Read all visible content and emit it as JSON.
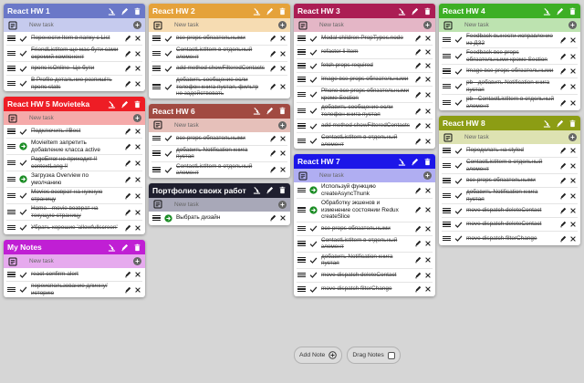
{
  "actions": {
    "add_note": "Add Note",
    "drag_notes": "Drag Notes"
  },
  "new_task_placeholder": "New task",
  "columns": [
    [
      {
        "title": "React HW 1",
        "header": "#6a78c8",
        "newtask": "#c6cbee",
        "tasks": [
          {
            "text": "Перенести Item в папку с List",
            "done": true
          },
          {
            "text": "FriendListItem ще має бути сами окремий компонент",
            "done": true
          },
          {
            "text": "пропс isOnline- Це бути",
            "done": true
          },
          {
            "text": "В Profile детальние розпишіть пропс stats",
            "done": true
          }
        ]
      },
      {
        "title": "React HW 5 Movieteka",
        "header": "#ee1d25",
        "newtask": "#f5aaaa",
        "tasks": [
          {
            "text": "Подключить //Best",
            "done": true
          },
          {
            "text": "MovieItem запретить добавление класса active",
            "done": false
          },
          {
            "text": "PageError не приходит !! contextLang !!",
            "done": true
          },
          {
            "text": "Загрузка Overview по умолчанию",
            "done": false
          },
          {
            "text": "Movies возврат на нужную страницу",
            "done": true
          },
          {
            "text": "Home - movie возврат на текущую страницу",
            "done": true
          },
          {
            "text": "Убрать хорошие 'allowfullscreen'",
            "done": true
          }
        ]
      },
      {
        "title": "My Notes",
        "header": "#c01fd4",
        "newtask": "#e6aaee",
        "tasks": [
          {
            "text": "react-confirm-alert",
            "done": true
          },
          {
            "text": "переиспользование длинну/историю",
            "done": true
          }
        ]
      }
    ],
    [
      {
        "title": "React HW 2",
        "header": "#e5a23a",
        "newtask": "#f6dcb2",
        "tasks": [
          {
            "text": "все props обязательными",
            "done": true
          },
          {
            "text": "ContactListItem в отдельный элемент",
            "done": true
          },
          {
            "text": "add method showFilteredContacts",
            "done": true
          },
          {
            "text": "добавить сообщение если телефон книга пустая, фильтр не задействовать",
            "done": true
          }
        ]
      },
      {
        "title": "React HW 6",
        "header": "#a14a41",
        "newtask": "#e6c0ba",
        "tasks": [
          {
            "text": "все props обязательными",
            "done": true
          },
          {
            "text": "добавить Notification книга пустая",
            "done": true
          },
          {
            "text": "ContactListItem в отдельный элемент",
            "done": true
          }
        ]
      },
      {
        "title": "Портфолио своих работ",
        "header": "#1e1e2e",
        "newtask": "#a8a8b8",
        "tasks": [
          {
            "text": "Выбрать дизайн",
            "done": false
          }
        ]
      }
    ],
    [
      {
        "title": "React HW 3",
        "header": "#ab1d54",
        "newtask": "#e4b6c6",
        "tasks": [
          {
            "text": "Modal children PropTypes.node",
            "done": true
          },
          {
            "text": "refactor li Item",
            "done": true
          },
          {
            "text": "fetch props required",
            "done": true
          },
          {
            "text": "Image все props обязательными",
            "done": true
          },
          {
            "text": "Phone все props обязательными кроме Section",
            "done": true
          },
          {
            "text": "добавить сообщение если телефон книга пустая",
            "done": true
          },
          {
            "text": "add method showFilteredContacts",
            "done": true
          },
          {
            "text": "ContactListItem в отдельный элемент",
            "done": true
          }
        ]
      },
      {
        "title": "React HW 7",
        "header": "#1c16e8",
        "newtask": "#b0aef2",
        "tasks": [
          {
            "text": "Используй функцию createAsyncThunk",
            "done": false
          },
          {
            "text": "Обработку экшенов и изменение состоянии Redux createSlice",
            "done": false
          },
          {
            "text": "все props обязательными",
            "done": true
          },
          {
            "text": "ContactListItem в отдельный элемент",
            "done": true
          },
          {
            "text": "добавить Notification книга пустая",
            "done": true
          },
          {
            "text": "move dispatch deleteContact",
            "done": true
          },
          {
            "text": "move dispatch filterChange",
            "done": true
          }
        ]
      }
    ],
    [
      {
        "title": "React HW 4",
        "header": "#3daf25",
        "newtask": "#bde3b0",
        "tasks": [
          {
            "text": "Feedback вынести исправление из ДЗ2",
            "done": true
          },
          {
            "text": "Feedback все props обязательными кроме Section",
            "done": true
          },
          {
            "text": "Image все props обязательными",
            "done": true
          },
          {
            "text": "pb - добавить Notification книга пустая",
            "done": true
          },
          {
            "text": "pb - ContactListItem в отдельный элемент",
            "done": true
          }
        ]
      },
      {
        "title": "React HW 8",
        "header": "#8c9d14",
        "newtask": "#dde2b2",
        "tasks": [
          {
            "text": "Переделать на styled",
            "done": true
          },
          {
            "text": "ContactListItem в отдельный элемент",
            "done": true
          },
          {
            "text": "все props обязательными",
            "done": true
          },
          {
            "text": "добавить Notification книга пустая",
            "done": true
          },
          {
            "text": "move dispatch deleteContact",
            "done": true
          },
          {
            "text": "move dispatch deleteContact",
            "done": true
          },
          {
            "text": "move dispatch filterChange",
            "done": true
          }
        ]
      }
    ]
  ]
}
